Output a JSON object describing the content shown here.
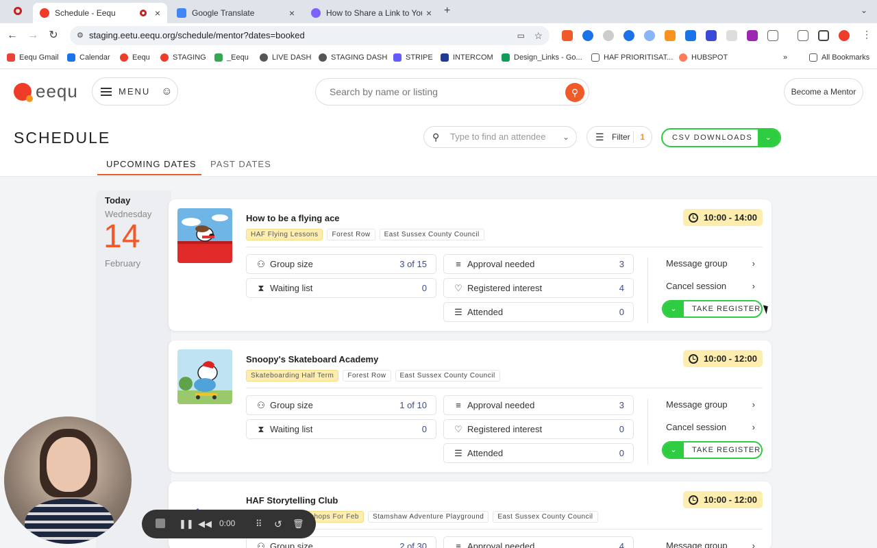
{
  "browser": {
    "tabs": [
      {
        "title": "Schedule - Eequ",
        "close": "×"
      },
      {
        "title": "Google Translate",
        "close": "×"
      },
      {
        "title": "How to Share a Link to Your E",
        "close": "×"
      }
    ],
    "new_tab": "+",
    "url": "staging.eetu.eequ.org/schedule/mentor?dates=booked",
    "bookmarks": [
      "Eequ Gmail",
      "Calendar",
      "Eequ",
      "STAGING",
      "_Eequ",
      "LIVE DASH",
      "STAGING DASH",
      "STRIPE",
      "INTERCOM",
      "Design_Links - Go...",
      "HAF PRIORITISAT...",
      "HUBSPOT"
    ],
    "bookmarks_overflow": "»",
    "all_bookmarks": "All Bookmarks",
    "bookmark_colors": [
      "#ea4335",
      "#1a73e8",
      "#ef3c29",
      "#ef3c29",
      "#34a853",
      "#555555",
      "#555555",
      "#635bff",
      "#1f3a93",
      "#0f9d58",
      "#555555",
      "#ff7a59"
    ]
  },
  "site": {
    "logo_text": "eequ",
    "menu_label": "MENU",
    "search_placeholder": "Search by name or listing",
    "become_mentor": "Become a Mentor"
  },
  "schedule": {
    "title": "SCHEDULE",
    "attendee_placeholder": "Type to find an attendee",
    "filter_label": "Filter",
    "filter_count": "1",
    "csv_label": "CSV DOWNLOADS",
    "tabs": [
      "UPCOMING DATES",
      "PAST DATES"
    ]
  },
  "date": {
    "today": "Today",
    "weekday": "Wednesday",
    "day": "14",
    "month": "February"
  },
  "sessions": [
    {
      "title": "How to be a flying ace",
      "tags": [
        "HAF Flying Lessons",
        "Forest Row",
        "East Sussex County Council"
      ],
      "time": "10:00 - 14:00",
      "stats": {
        "group_size": "3 of 15",
        "waiting_list": "0",
        "approval_needed": "3",
        "registered_interest": "4",
        "attended": "0"
      }
    },
    {
      "title": "Snoopy's Skateboard Academy",
      "tags": [
        "Skateboarding Half Term",
        "Forest Row",
        "East Sussex County Council"
      ],
      "time": "10:00 - 12:00",
      "stats": {
        "group_size": "1 of 10",
        "waiting_list": "0",
        "approval_needed": "3",
        "registered_interest": "0",
        "attended": "0"
      }
    },
    {
      "title": "HAF Storytelling Club",
      "tags": [
        "shops For Feb",
        "Stamshaw Adventure Playground",
        "East Sussex County Council"
      ],
      "time": "10:00 - 12:00",
      "stats": {
        "group_size": "2 of 30",
        "approval_needed": "4"
      }
    }
  ],
  "labels": {
    "group_size": "Group size",
    "waiting_list": "Waiting list",
    "approval_needed": "Approval needed",
    "registered_interest": "Registered interest",
    "attended": "Attended",
    "message_group": "Message group",
    "cancel_session": "Cancel session",
    "take_register": "TAKE REGISTER"
  },
  "recorder": {
    "timer": "0:00"
  },
  "colors": {
    "accent": "#f05a28",
    "green": "#2ecc40",
    "highlight": "#fdeeb0",
    "value_blue": "#3b4a9c"
  }
}
